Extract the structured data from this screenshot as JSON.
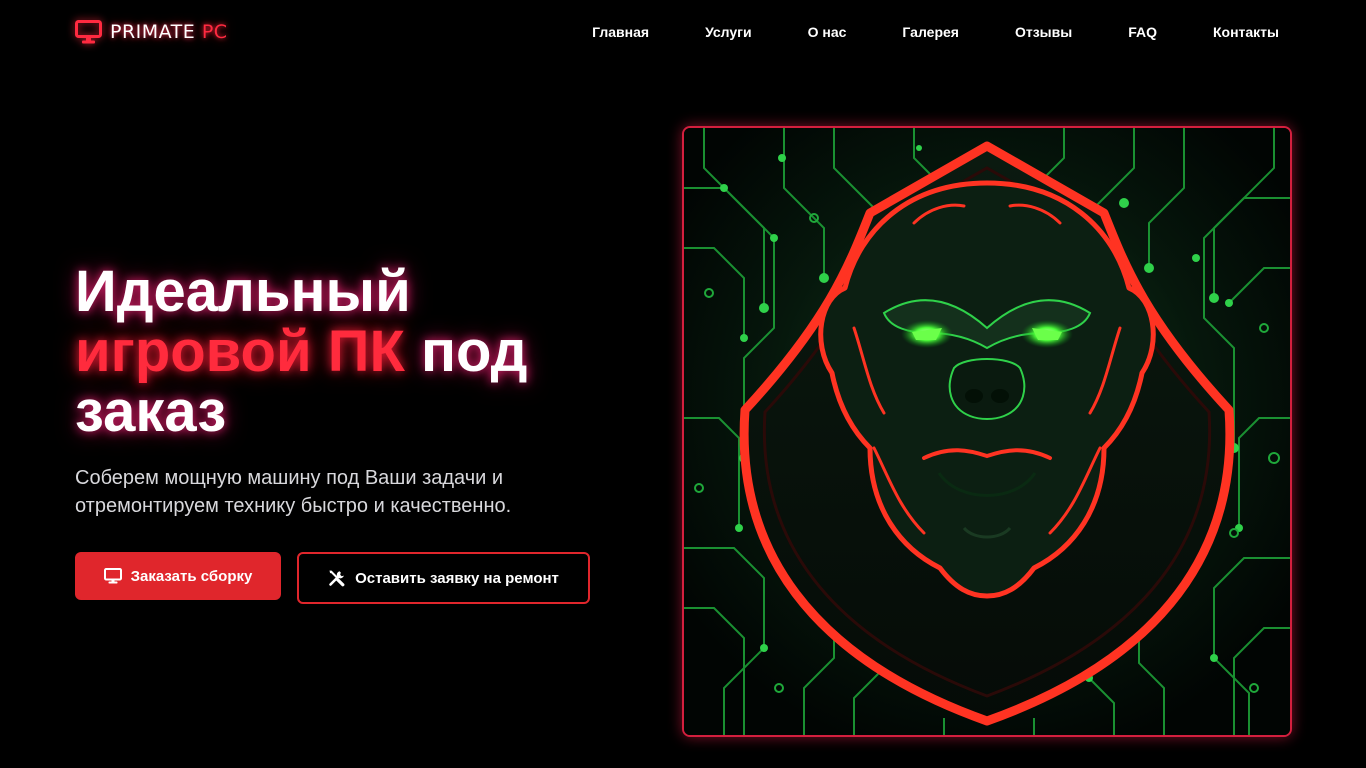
{
  "brand": {
    "name_part1": "PRIMATE",
    "name_part2": "PC",
    "icon": "monitor-icon",
    "colors": {
      "accent": "#ff2a40",
      "text": "#ffffff"
    }
  },
  "nav": {
    "items": [
      {
        "label": "Главная"
      },
      {
        "label": "Услуги"
      },
      {
        "label": "О нас"
      },
      {
        "label": "Галерея"
      },
      {
        "label": "Отзывы"
      },
      {
        "label": "FAQ"
      },
      {
        "label": "Контакты"
      }
    ]
  },
  "hero": {
    "title_line1": "Идеальный",
    "title_accent": "игровой ПК",
    "title_after_accent": "под",
    "title_line3": "заказ",
    "subtitle": "Соберем мощную машину под Ваши задачи и отремонтируем технику быстро и качественно.",
    "primary_button": {
      "label": "Заказать сборку",
      "icon": "monitor-icon"
    },
    "secondary_button": {
      "label": "Оставить заявку на ремонт",
      "icon": "tools-icon"
    },
    "image": {
      "subject": "gorilla-mascot-circuit-board"
    },
    "colors": {
      "accent": "#e0262c",
      "glow": "#ff2b3d",
      "subtitle": "#d8d8dc",
      "background": "#000000",
      "image_border": "#d41f3e",
      "circuit_green": "#2fd14a",
      "mascot_outline": "#ff3322",
      "eyes": "#4dff3a"
    }
  }
}
